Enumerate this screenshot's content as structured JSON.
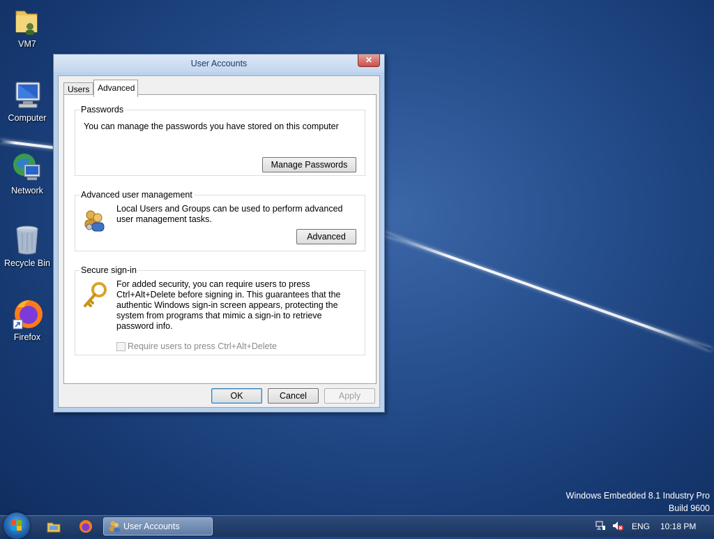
{
  "desktop": {
    "icons": [
      {
        "label": "VM7"
      },
      {
        "label": "Computer"
      },
      {
        "label": "Network"
      },
      {
        "label": "Recycle Bin"
      },
      {
        "label": "Firefox"
      }
    ],
    "watermark": {
      "line1": "Windows Embedded 8.1 Industry Pro",
      "line2": "Build 9600"
    }
  },
  "dialog": {
    "title": "User Accounts",
    "close_label": "✕",
    "tabs": [
      {
        "label": "Users"
      },
      {
        "label": "Advanced"
      }
    ],
    "passwords": {
      "legend": "Passwords",
      "text": "You can manage the passwords you have stored on this computer",
      "button_label": "Manage Passwords"
    },
    "advanced_mgmt": {
      "legend": "Advanced user management",
      "text": "Local Users and Groups can be used to perform advanced user management tasks.",
      "button_label": "Advanced"
    },
    "secure_signin": {
      "legend": "Secure sign-in",
      "text": "For added security, you can require users to press Ctrl+Alt+Delete before signing in. This guarantees that the authentic Windows sign-in screen appears, protecting the system from programs that mimic a sign-in to retrieve password info.",
      "checkbox_label": "Require users to press Ctrl+Alt+Delete"
    },
    "buttons": {
      "ok": "OK",
      "cancel": "Cancel",
      "apply": "Apply"
    }
  },
  "taskbar": {
    "task_label": "User Accounts",
    "language": "ENG",
    "clock": "10:18 PM"
  }
}
